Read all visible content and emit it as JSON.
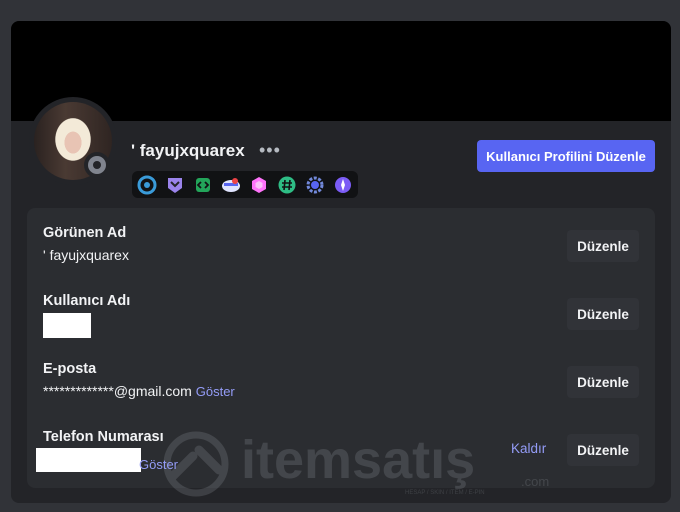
{
  "profile": {
    "username": "' fayujxquarex",
    "more_icon": "•••",
    "edit_profile_button": "Kullanıcı Profilini Düzenle",
    "status": "offline",
    "badges": [
      {
        "icon": "nitro-badge-icon",
        "color": "#3a9bd9"
      },
      {
        "icon": "hypesquad-badge-icon",
        "color": "#9b84ec"
      },
      {
        "icon": "active-developer-badge-icon",
        "color": "#23a55a"
      },
      {
        "icon": "early-supporter-badge-icon",
        "color": "#e0e4ff"
      },
      {
        "icon": "server-boost-badge-icon",
        "color": "#ff73fa"
      },
      {
        "icon": "quest-badge-icon",
        "color": "#2ebd85"
      },
      {
        "icon": "bug-hunter-badge-icon",
        "color": "#7289da"
      },
      {
        "icon": "nitro-gem-badge-icon",
        "color": "#7b5cf5"
      }
    ]
  },
  "fields": {
    "display_name": {
      "label": "Görünen Ad",
      "value": "' fayujxquarex",
      "edit": "Düzenle"
    },
    "username": {
      "label": "Kullanıcı Adı",
      "value": "",
      "edit": "Düzenle"
    },
    "email": {
      "label": "E-posta",
      "value": "*************@gmail.com",
      "reveal": "Göster",
      "edit": "Düzenle"
    },
    "phone": {
      "label": "Telefon Numarası",
      "value": "",
      "reveal": "Göster",
      "remove": "Kaldır",
      "edit": "Düzenle"
    }
  },
  "watermark": {
    "brand": "itemsatış",
    "suffix": ".com",
    "tagline": "HESAP / SKIN / ITEM / E-PIN"
  },
  "colors": {
    "accent": "#5865f2",
    "link": "#949cf7",
    "background": "#313338",
    "card": "#232428",
    "panel": "#2b2d31"
  }
}
